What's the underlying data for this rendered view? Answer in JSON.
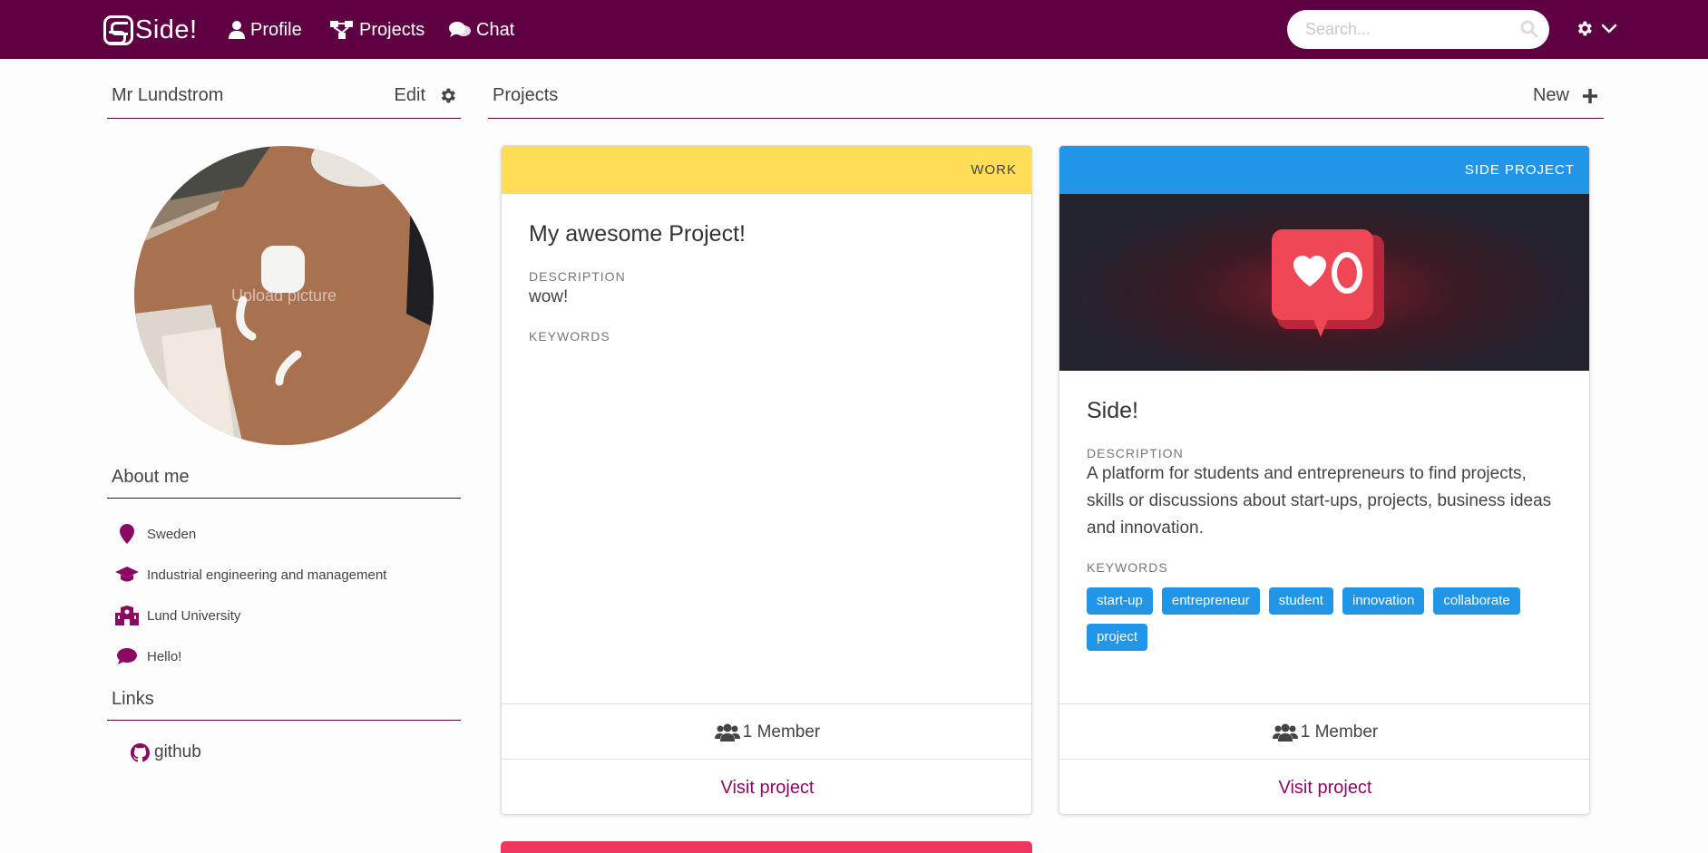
{
  "brand": {
    "name": "Side!"
  },
  "nav": {
    "profile": "Profile",
    "projects": "Projects",
    "chat": "Chat"
  },
  "search": {
    "placeholder": "Search..."
  },
  "profile": {
    "name": "Mr Lundstrom",
    "edit_label": "Edit",
    "avatar_label": "Upload picture"
  },
  "about": {
    "title": "About me",
    "items": [
      {
        "icon": "map-marker-icon",
        "text": "Sweden"
      },
      {
        "icon": "graduation-cap-icon",
        "text": "Industrial engineering and management"
      },
      {
        "icon": "university-icon",
        "text": "Lund University"
      },
      {
        "icon": "comment-icon",
        "text": "Hello!"
      }
    ]
  },
  "links": {
    "title": "Links",
    "items": [
      {
        "icon": "github-icon",
        "text": "github"
      }
    ]
  },
  "projects_section": {
    "title": "Projects",
    "new_label": "New"
  },
  "projects": [
    {
      "category": "WORK",
      "category_color": "#ffdd57",
      "title": "My awesome Project!",
      "description_label": "DESCRIPTION",
      "description": "wow!",
      "keywords_label": "KEYWORDS",
      "keywords": [],
      "members": "1 Member",
      "visit_label": "Visit project"
    },
    {
      "category": "SIDE PROJECT",
      "category_color": "#2196e8",
      "title": "Side!",
      "description_label": "DESCRIPTION",
      "description": "A platform for students and entrepreneurs to find projects, skills or discussions about start-ups, projects, business ideas and innovation.",
      "keywords_label": "KEYWORDS",
      "keywords": [
        "start-up",
        "entrepreneur",
        "student",
        "innovation",
        "collaborate",
        "project"
      ],
      "members": "1 Member",
      "visit_label": "Visit project"
    }
  ],
  "colors": {
    "brand": "#5e0042",
    "accent": "#8a0a63",
    "tag": "#2196e8",
    "next_card": "#f0365f"
  }
}
